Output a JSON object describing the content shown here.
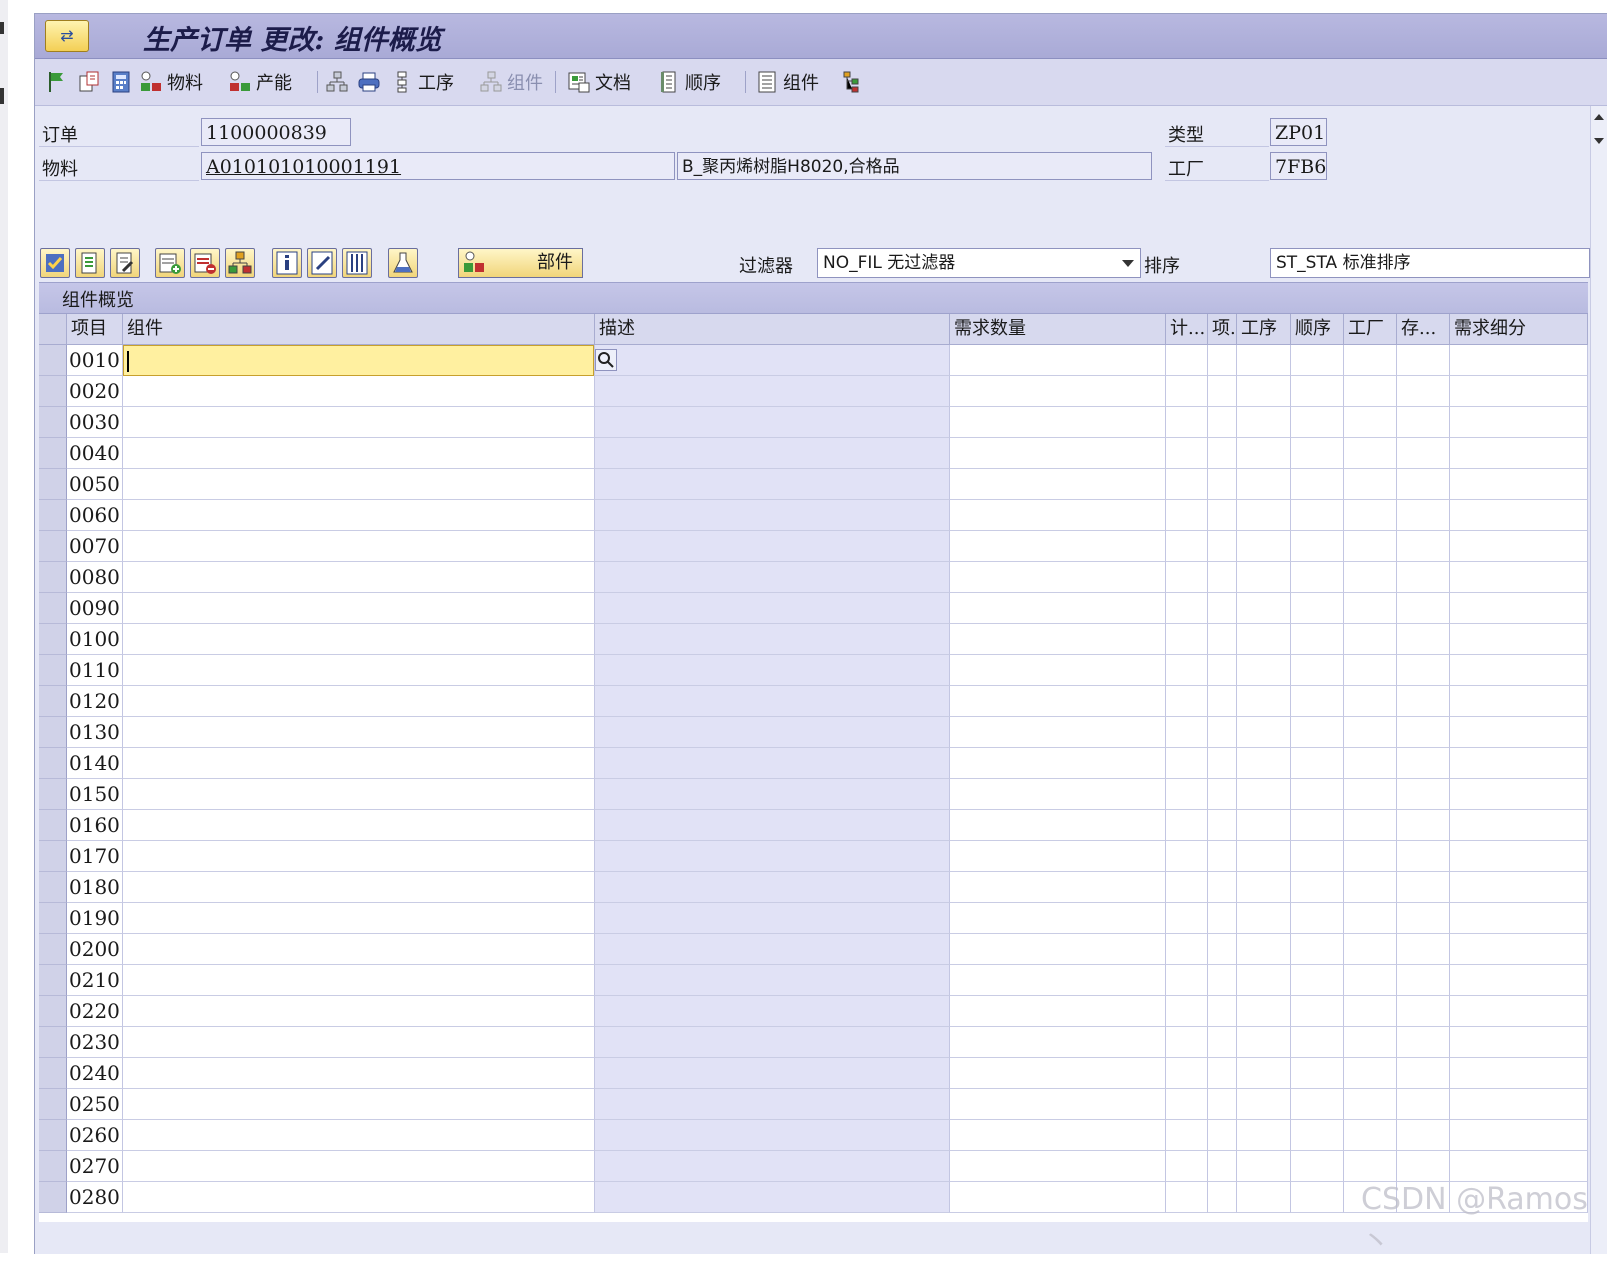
{
  "title": "生产订单 更改: 组件概览",
  "toolbar": {
    "material": "物料",
    "capacity": "产能",
    "operations": "工序",
    "components_disabled": "组件",
    "documents": "文档",
    "sequence": "顺序",
    "components": "组件"
  },
  "header": {
    "order_label": "订单",
    "order_value": "1100000839",
    "material_label": "物料",
    "material_value": "A010101010001191",
    "material_desc": "B_聚丙烯树脂H8020,合格品",
    "type_label": "类型",
    "type_value": "ZP01",
    "plant_label": "工厂",
    "plant_value": "7FB6"
  },
  "controls": {
    "parts_label": "部件",
    "filter_label": "过滤器",
    "filter_value": "NO_FIL 无过滤器",
    "sort_label": "排序",
    "sort_value": "ST_STA 标准排序"
  },
  "grid": {
    "title": "组件概览",
    "columns": [
      "项目",
      "组件",
      "描述",
      "需求数量",
      "计...",
      "项.",
      "工序",
      "顺序",
      "工厂",
      "存...",
      "需求细分"
    ],
    "items": [
      "0010",
      "0020",
      "0030",
      "0040",
      "0050",
      "0060",
      "0070",
      "0080",
      "0090",
      "0100",
      "0110",
      "0120",
      "0130",
      "0140",
      "0150",
      "0160",
      "0170",
      "0180",
      "0190",
      "0200",
      "0210",
      "0220",
      "0230",
      "0240",
      "0250",
      "0260",
      "0270",
      "0280"
    ]
  },
  "watermark": "CSDN @Ramos丶"
}
